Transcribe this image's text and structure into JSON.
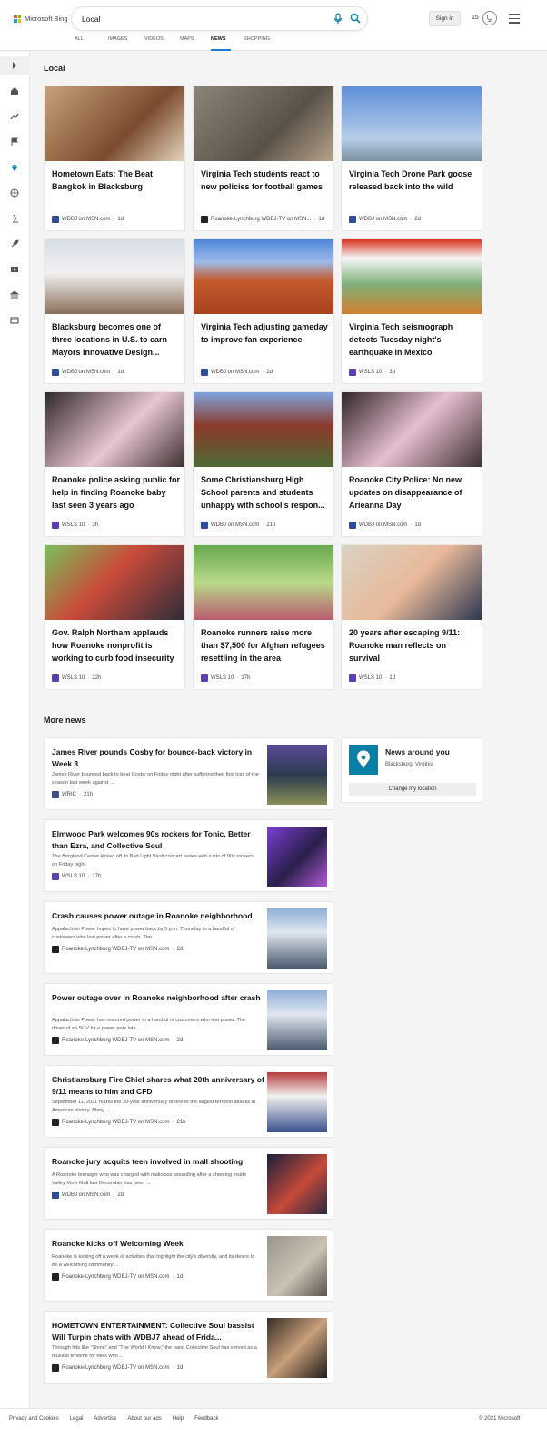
{
  "brand": {
    "name": "Microsoft Bing",
    "colors": [
      "#f25022",
      "#7fba00",
      "#00a4ef",
      "#ffb900"
    ]
  },
  "search": {
    "value": "Local",
    "placeholder": ""
  },
  "header": {
    "sign_in": "Sign in",
    "points": "15"
  },
  "tabs": [
    {
      "label": "ALL"
    },
    {
      "label": "IMAGES"
    },
    {
      "label": "VIDEOS"
    },
    {
      "label": "MAPS"
    },
    {
      "label": "NEWS",
      "active": true
    },
    {
      "label": "SHOPPING"
    }
  ],
  "sidebar_icons": [
    "expand-icon",
    "home-icon",
    "trending-icon",
    "flag-icon",
    "location-icon",
    "globe-icon",
    "science-icon",
    "rocket-icon",
    "video-icon",
    "government-icon",
    "finance-icon"
  ],
  "local": {
    "title": "Local",
    "cards": [
      {
        "title": "Hometown Eats: The Beat Bangkok in Blacksburg",
        "source": "WDBJ on MSN.com",
        "age": "1d"
      },
      {
        "title": "Virginia Tech students react to new policies for football games",
        "source": "Roanoke-Lynchburg WDBJ-TV on MSN...",
        "age": "1d"
      },
      {
        "title": "Virginia Tech Drone Park goose released back into the wild",
        "source": "WDBJ on MSN.com",
        "age": "2d"
      },
      {
        "title": "Blacksburg becomes one of three locations in U.S. to earn Mayors Innovative Design...",
        "source": "WDBJ on MSN.com",
        "age": "1d"
      },
      {
        "title": "Virginia Tech adjusting gameday to improve fan experience",
        "source": "WDBJ on MSN.com",
        "age": "2d"
      },
      {
        "title": "Virginia Tech seismograph detects Tuesday night's earthquake in Mexico",
        "source": "WSLS 10",
        "age": "3d"
      },
      {
        "title": "Roanoke police asking public for help in finding Roanoke baby last seen 3 years ago",
        "source": "WSLS 10",
        "age": "3h"
      },
      {
        "title": "Some Christiansburg High School parents and students unhappy with school's respon...",
        "source": "WDBJ on MSN.com",
        "age": "21h"
      },
      {
        "title": "Roanoke City Police: No new updates on disappearance of Arieanna Day",
        "source": "WDBJ on MSN.com",
        "age": "1d"
      },
      {
        "title": "Gov. Ralph Northam applauds how Roanoke nonprofit is working to curb food insecurity",
        "source": "WSLS 10",
        "age": "22h"
      },
      {
        "title": "Roanoke runners raise more than $7,500 for Afghan refugees resettling in the area",
        "source": "WSLS 10",
        "age": "17h"
      },
      {
        "title": "20 years after escaping 9/11: Roanoke man reflects on survival",
        "source": "WSLS 10",
        "age": "1d"
      }
    ]
  },
  "more": {
    "title": "More news",
    "items": [
      {
        "title": "James River pounds Cosby for bounce-back victory in Week 3",
        "desc": "James River bounced back to beat Cosby on Friday night after suffering their first loss of the season last week against ...",
        "source": "WRIC",
        "age": "21h"
      },
      {
        "title": "Elmwood Park welcomes 90s rockers for Tonic, Better than Ezra, and Collective Soul",
        "desc": "The Berglund Center kicked off its Bud Light Vault concert series with a trio of 90s rockers on Friday night.",
        "source": "WSLS 10",
        "age": "17h"
      },
      {
        "title": "Crash causes power outage in Roanoke neighborhood",
        "desc": "Appalachian Power hopes to have power back by 5 p.m. Thursday to a handful of customers who lost power after a crash. The ...",
        "source": "Roanoke-Lynchburg WDBJ-TV on MSN.com",
        "age": "2d"
      },
      {
        "title": "Power outage over in Roanoke neighborhood after crash",
        "desc": "Appalachian Power has restored power to a handful of customers who lost power. The driver of an SUV hit a power pole late ...",
        "source": "Roanoke-Lynchburg WDBJ-TV on MSN.com",
        "age": "2d"
      },
      {
        "title": "Christiansburg Fire Chief shares what 20th anniversary of 9/11 means to him and CFD",
        "desc": "September 11, 2021 marks the 20-year anniversary of one of the largest terrorist attacks in American history. Many ...",
        "source": "Roanoke-Lynchburg WDBJ-TV on MSN.com",
        "age": "21h"
      },
      {
        "title": "Roanoke jury acquits teen involved in mall shooting",
        "desc": "A Roanoke teenager who was charged with malicious wounding after a shooting inside Valley View Mall last December has been ...",
        "source": "WDBJ on MSN.com",
        "age": "2d"
      },
      {
        "title": "Roanoke kicks off Welcoming Week",
        "desc": "Roanoke is kicking off a week of activities that highlight the city's diversity, and its desire to be a welcoming community ...",
        "source": "Roanoke-Lynchburg WDBJ-TV on MSN.com",
        "age": "1d"
      },
      {
        "title": "HOMETOWN ENTERTAINMENT: Collective Soul bassist Will Turpin chats with WDBJ7 ahead of Frida...",
        "desc": "Through hits like \"Shine\" and \"The World I Know,\" the band Collective Soul has served as a musical timeline for folks who ...",
        "source": "Roanoke-Lynchburg WDBJ-TV on MSN.com",
        "age": "1d"
      }
    ]
  },
  "location": {
    "title": "News around you",
    "place": "Blacksburg, Virginia",
    "button": "Change my location"
  },
  "footer": {
    "links": [
      "Privacy and Cookies",
      "Legal",
      "Advertise",
      "About our ads",
      "Help",
      "Feedback"
    ],
    "copyright": "© 2021 Microsoft"
  }
}
